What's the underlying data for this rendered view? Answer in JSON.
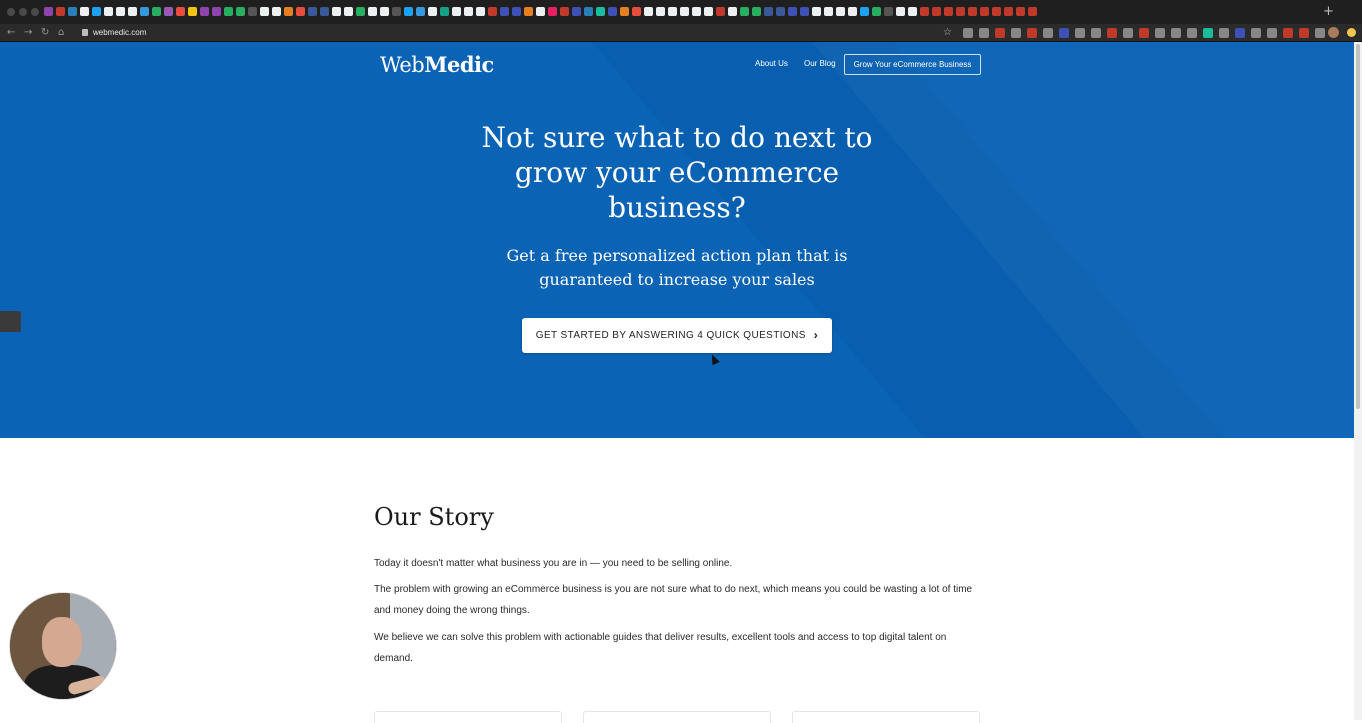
{
  "browser": {
    "url": "webmedic.com",
    "new_tab": "+"
  },
  "header": {
    "logo_light": "Web",
    "logo_bold": "Medic",
    "nav": [
      {
        "label": "About Us"
      },
      {
        "label": "Our Blog"
      }
    ],
    "cta_label": "Grow Your eCommerce Business"
  },
  "hero": {
    "title": "Not sure what to do next to grow your eCommerce business?",
    "subtitle": "Get a free personalized action plan that is guaranteed to increase your sales",
    "button_label": "GET STARTED BY ANSWERING 4 QUICK QUESTIONS",
    "button_icon": "chevron-right-icon",
    "background_color": "#0a63b5"
  },
  "story": {
    "title": "Our Story",
    "paragraphs": [
      "Today it doesn't matter what business you are in — you need to be selling online.",
      "The problem with growing an eCommerce business is you are not sure what to do next, which means you could be wasting a lot of time and money doing the wrong things.",
      "We believe we can solve this problem with actionable guides that deliver results, excellent tools and access to top digital talent on demand."
    ]
  }
}
